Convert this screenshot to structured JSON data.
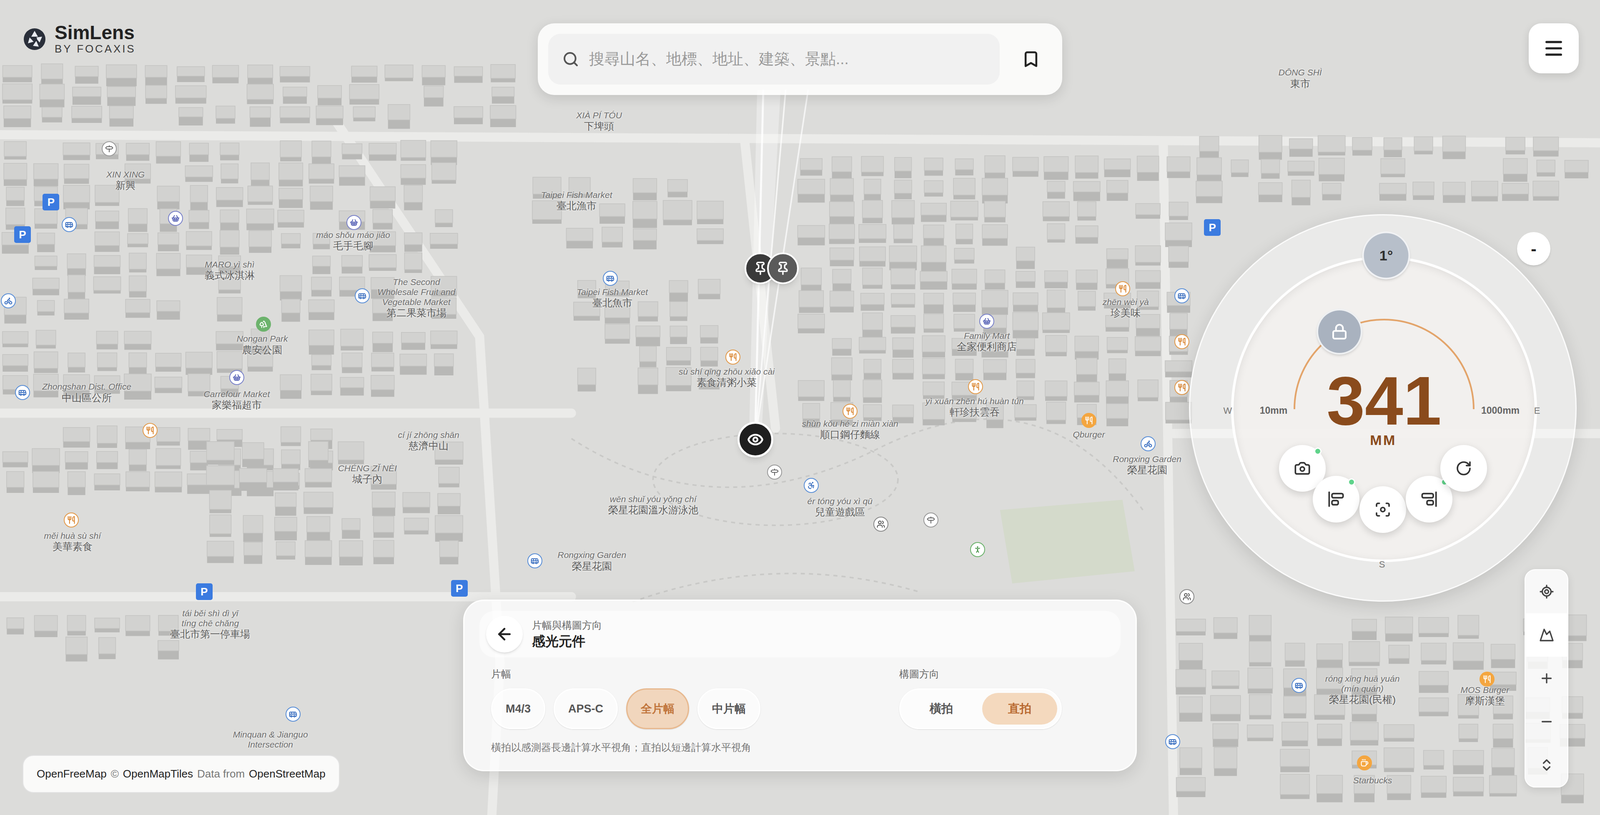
{
  "app": {
    "name": "SimLens",
    "byline": "BY FOCAXIS"
  },
  "search": {
    "placeholder": "搜尋山名、地標、地址、建築、景點..."
  },
  "map": {
    "labels": [
      {
        "lines": [
          "XIN XING",
          "新興"
        ]
      },
      {
        "lines": [
          "DŌNG SHÌ",
          "東市"
        ]
      },
      {
        "lines": [
          "XIÀ PÍ TÓU",
          "下埤頭"
        ]
      },
      {
        "lines": [
          "Taipei Fish Market",
          "臺北漁市"
        ]
      },
      {
        "lines": [
          "máo shǒu máo jiǎo",
          "毛手毛腳"
        ]
      },
      {
        "lines": [
          "MARO yì shì",
          "義式冰淇淋"
        ]
      },
      {
        "lines": [
          "The Second",
          "Wholesale Fruit and",
          "Vegetable Market",
          "第二果菜市場"
        ]
      },
      {
        "lines": [
          "Taipei Fish Market",
          "臺北魚市"
        ]
      },
      {
        "lines": [
          "zhēn wèi yà",
          "珍美味"
        ]
      },
      {
        "lines": [
          "Nongan Park",
          "農安公園"
        ]
      },
      {
        "lines": [
          "Family Mart",
          "全家便利商店"
        ]
      },
      {
        "lines": [
          "sù shí qīng zhōu xiǎo cài",
          "素食清粥小菜"
        ]
      },
      {
        "lines": [
          "Carrefour Market",
          "家樂福超市"
        ]
      },
      {
        "lines": [
          "Zhongshan Dist. Office",
          "中山區公所"
        ]
      },
      {
        "lines": [
          "yì xuān zhēn hú huàn tún",
          "軒珍扶雲吞"
        ]
      },
      {
        "lines": [
          "shùn kǒu hé zi miàn xiàn",
          "順口鋼仔麵線"
        ]
      },
      {
        "lines": [
          "Qburger"
        ]
      },
      {
        "lines": [
          "cí jí zhōng shān",
          "慈濟中山"
        ]
      },
      {
        "lines": [
          "Rongxing Garden",
          "榮星花園"
        ]
      },
      {
        "lines": [
          "CHÉNG ZǏ NÈI",
          "城子內"
        ]
      },
      {
        "lines": [
          "wēn shuǐ yóu yǒng chí",
          "榮星花園溫水游泳池"
        ]
      },
      {
        "lines": [
          "ér tóng yóu xì qū",
          "兒童遊戲區"
        ]
      },
      {
        "lines": [
          "měi huà sù shí",
          "美華素食"
        ]
      },
      {
        "lines": [
          "Rongxing Garden",
          "榮星花園"
        ]
      },
      {
        "lines": [
          "tái běi shì dì yī",
          "tíng chē chǎng",
          "臺北市第一停車場"
        ]
      },
      {
        "lines": [
          "róng xīng huā yuán",
          "(mín quán)",
          "榮星花園(民權)"
        ]
      },
      {
        "lines": [
          "MOS Burger",
          "摩斯漢堡"
        ]
      },
      {
        "lines": [
          "Minquan & Jianguo",
          "Intersection"
        ]
      },
      {
        "lines": [
          "Starbucks"
        ]
      }
    ],
    "pois": [
      {
        "kind": "parking",
        "text": "P"
      },
      {
        "kind": "parking",
        "text": "P"
      },
      {
        "kind": "parking",
        "text": "P"
      },
      {
        "kind": "parking",
        "text": "P"
      },
      {
        "kind": "parking",
        "text": "P"
      },
      {
        "kind": "food"
      },
      {
        "kind": "food"
      },
      {
        "kind": "food"
      },
      {
        "kind": "food"
      },
      {
        "kind": "food"
      },
      {
        "kind": "food"
      },
      {
        "kind": "food"
      },
      {
        "kind": "food"
      },
      {
        "kind": "bus"
      },
      {
        "kind": "bus"
      },
      {
        "kind": "bus"
      },
      {
        "kind": "bus"
      },
      {
        "kind": "bus"
      },
      {
        "kind": "bus"
      },
      {
        "kind": "bus"
      },
      {
        "kind": "bus"
      },
      {
        "kind": "bus"
      },
      {
        "kind": "shop"
      },
      {
        "kind": "shop"
      },
      {
        "kind": "shop"
      },
      {
        "kind": "shop"
      },
      {
        "kind": "park"
      },
      {
        "kind": "toilet"
      },
      {
        "kind": "toilet"
      },
      {
        "kind": "bike"
      },
      {
        "kind": "bike"
      },
      {
        "kind": "burger"
      },
      {
        "kind": "burger"
      },
      {
        "kind": "coffee"
      },
      {
        "kind": "misc"
      },
      {
        "kind": "misc"
      },
      {
        "kind": "misc"
      },
      {
        "kind": "accessible"
      },
      {
        "kind": "fitness"
      }
    ],
    "markers": [
      {
        "kind": "viewpoint"
      },
      {
        "kind": "pin"
      },
      {
        "kind": "pin"
      }
    ]
  },
  "lens_dial": {
    "angle": "1°",
    "focal": "341",
    "unit": "MM",
    "min": "10mm",
    "max": "1000mm",
    "level": 0.334,
    "locked": true,
    "compass": [
      "W",
      "E",
      "S"
    ],
    "collapse": "-",
    "buttons": [
      {
        "indicator": true
      },
      {
        "indicator": true
      },
      {
        "indicator": false
      },
      {
        "indicator": true
      },
      {
        "indicator": false
      }
    ]
  },
  "tools": [
    {
      "selected": false
    },
    {
      "selected": true
    },
    {
      "selected": false
    },
    {
      "selected": false
    },
    {
      "selected": false
    }
  ],
  "panel": {
    "subtitle": "片幅與構圖方向",
    "title": "感光元件",
    "format_label": "片幅",
    "formats": [
      {
        "label": "M4/3",
        "selected": false
      },
      {
        "label": "APS-C",
        "selected": false
      },
      {
        "label": "全片幅",
        "selected": true
      },
      {
        "label": "中片幅",
        "selected": false
      }
    ],
    "orientation_label": "構圖方向",
    "orientations": [
      {
        "label": "橫拍",
        "selected": false
      },
      {
        "label": "直拍",
        "selected": true
      }
    ],
    "note": "橫拍以感測器長邊計算水平視角；直拍以短邊計算水平視角"
  },
  "attribution": [
    {
      "text": "OpenFreeMap",
      "link": true
    },
    {
      "text": "©",
      "link": false
    },
    {
      "text": "OpenMapTiles",
      "link": true
    },
    {
      "text": "Data from",
      "link": false
    },
    {
      "text": "OpenStreetMap",
      "link": true
    }
  ]
}
